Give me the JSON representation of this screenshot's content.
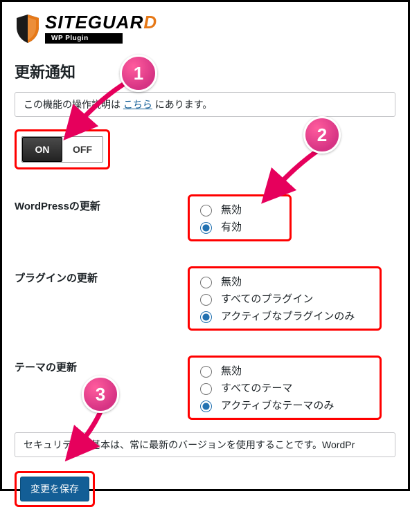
{
  "logo": {
    "text_main": "SITEGUAR",
    "text_last": "D",
    "sub": "WP Plugin"
  },
  "page_title": "更新通知",
  "info": {
    "prefix": "この機能の操作説明は ",
    "link": "こちら",
    "suffix": " にあります。"
  },
  "toggle": {
    "on": "ON",
    "off": "OFF",
    "state": "on"
  },
  "rows": {
    "wordpress": {
      "label": "WordPressの更新",
      "options": [
        {
          "label": "無効",
          "checked": false
        },
        {
          "label": "有効",
          "checked": true
        }
      ]
    },
    "plugin": {
      "label": "プラグインの更新",
      "options": [
        {
          "label": "無効",
          "checked": false
        },
        {
          "label": "すべてのプラグイン",
          "checked": false
        },
        {
          "label": "アクティブなプラグインのみ",
          "checked": true
        }
      ]
    },
    "theme": {
      "label": "テーマの更新",
      "options": [
        {
          "label": "無効",
          "checked": false
        },
        {
          "label": "すべてのテーマ",
          "checked": false
        },
        {
          "label": "アクティブなテーマのみ",
          "checked": true
        }
      ]
    }
  },
  "note": "セキュリティの基本は、常に最新のバージョンを使用することです。WordPr",
  "save": "変更を保存",
  "annotations": {
    "b1": "1",
    "b2": "2",
    "b3": "3"
  }
}
